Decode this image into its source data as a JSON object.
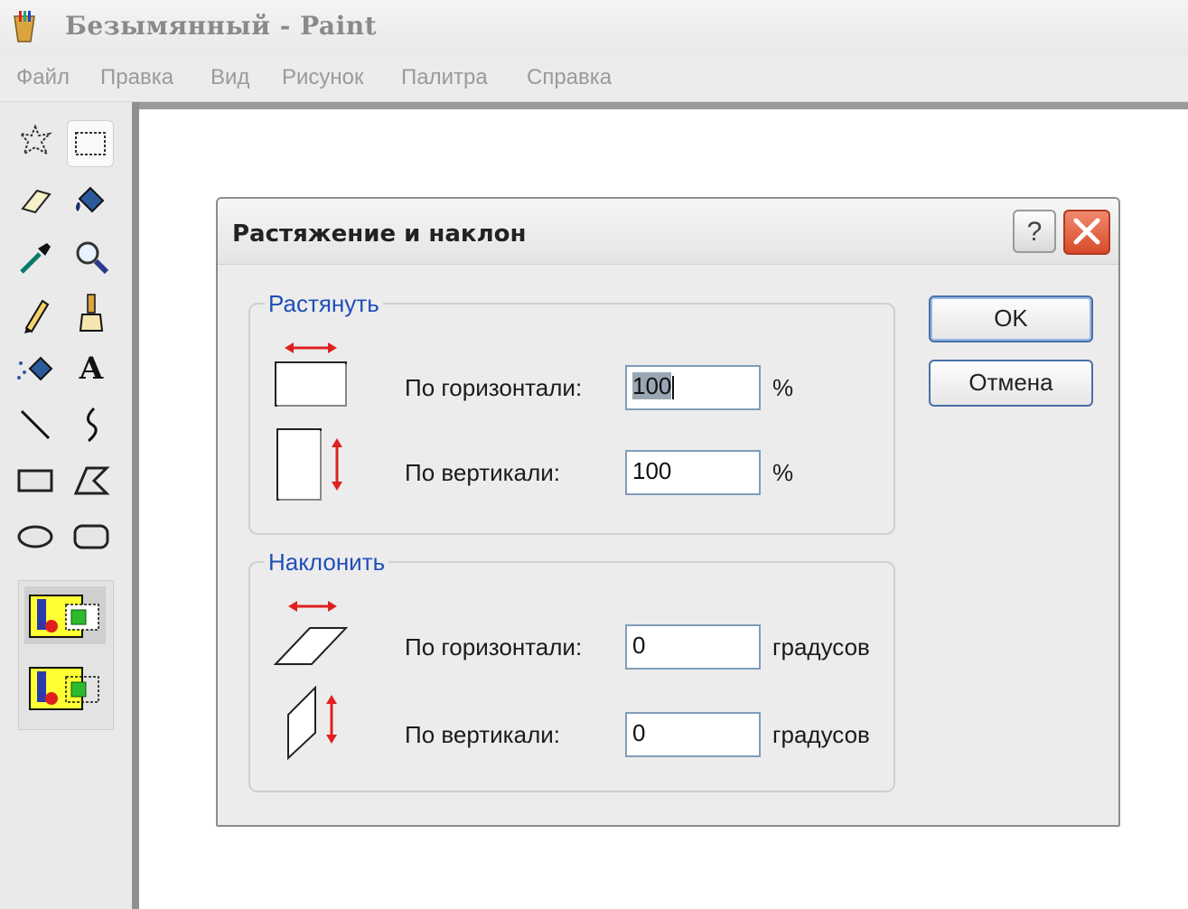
{
  "window": {
    "title": "Безымянный - Paint"
  },
  "menu": {
    "items": [
      "Файл",
      "Правка",
      "Вид",
      "Рисунок",
      "Палитра",
      "Справка"
    ]
  },
  "toolbox": {
    "tools": [
      {
        "name": "free-form-select-icon"
      },
      {
        "name": "rect-select-icon",
        "selected": true
      },
      {
        "name": "eraser-icon"
      },
      {
        "name": "fill-bucket-icon"
      },
      {
        "name": "color-picker-icon"
      },
      {
        "name": "magnifier-icon"
      },
      {
        "name": "pencil-icon"
      },
      {
        "name": "brush-icon"
      },
      {
        "name": "airbrush-icon"
      },
      {
        "name": "text-tool-icon",
        "glyph": "A"
      },
      {
        "name": "line-icon"
      },
      {
        "name": "curve-icon"
      },
      {
        "name": "rectangle-icon"
      },
      {
        "name": "polygon-icon"
      },
      {
        "name": "ellipse-icon"
      },
      {
        "name": "rounded-rect-icon"
      }
    ],
    "selection_options": [
      "opaque-selection-icon",
      "transparent-selection-icon"
    ]
  },
  "dialog": {
    "title": "Растяжение и наклон",
    "help_button": "?",
    "stretch": {
      "label": "Растянуть",
      "horizontal_label": "По горизонтали:",
      "horizontal_value": "100",
      "horizontal_unit": "%",
      "vertical_label": "По вертикали:",
      "vertical_value": "100",
      "vertical_unit": "%"
    },
    "skew": {
      "label": "Наклонить",
      "horizontal_label": "По горизонтали:",
      "horizontal_value": "0",
      "horizontal_unit": "градусов",
      "vertical_label": "По вертикали:",
      "vertical_value": "0",
      "vertical_unit": "градусов"
    },
    "ok_label": "OK",
    "cancel_label": "Отмена"
  },
  "colors": {
    "group_label": "#1f4fb8",
    "arrow_red": "#e02020",
    "close_button": "#d84a28",
    "selection_highlight": "#ffff33"
  }
}
